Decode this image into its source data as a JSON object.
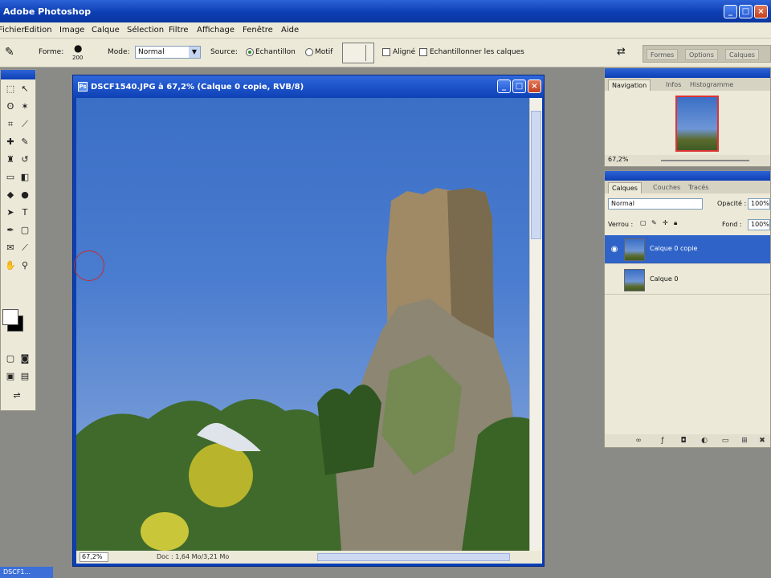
{
  "app": {
    "title": "Adobe Photoshop",
    "window_buttons": [
      "_",
      "□",
      "×"
    ]
  },
  "menu": [
    "Fichier",
    "Edition",
    "Image",
    "Calque",
    "Sélection",
    "Filtre",
    "Affichage",
    "Fenêtre",
    "Aide"
  ],
  "options_bar": {
    "forme_label": "Forme:",
    "brush_size": "200",
    "mode_label": "Mode:",
    "mode_value": "Normal",
    "source_label": "Source:",
    "source_sample": "Echantillon",
    "source_motif": "Motif",
    "align_label": "Aligné",
    "sample_all_label": "Echantillonner les calques",
    "palette_tabs": [
      "Formes",
      "Options",
      "Calques"
    ]
  },
  "document": {
    "title": "DSCF1540.JPG à 67,2% (Calque 0 copie, RVB/8)",
    "zoom": "67,2%",
    "status_info": "Doc : 1,64 Mo/3,21 Mo"
  },
  "navigator": {
    "tabs": [
      "Navigation",
      "Infos",
      "Histogramme"
    ],
    "zoom": "67,2%"
  },
  "layers": {
    "tabs": [
      "Calques",
      "Couches",
      "Tracés"
    ],
    "blend_mode": "Normal",
    "opacity_label": "Opacité :",
    "opacity_value": "100%",
    "lock_label": "Verrou :",
    "fill_label": "Fond :",
    "fill_value": "100%",
    "items": [
      {
        "name": "Calque 0 copie",
        "visible": true,
        "selected": true
      },
      {
        "name": "Calque 0",
        "visible": false,
        "selected": false
      }
    ]
  },
  "taskbar": {
    "item": "DSCF1..."
  },
  "colors": {
    "xp_blue": "#0d3fb4",
    "selected_layer": "#2f63c8",
    "panel_bg": "#ece9d8"
  }
}
